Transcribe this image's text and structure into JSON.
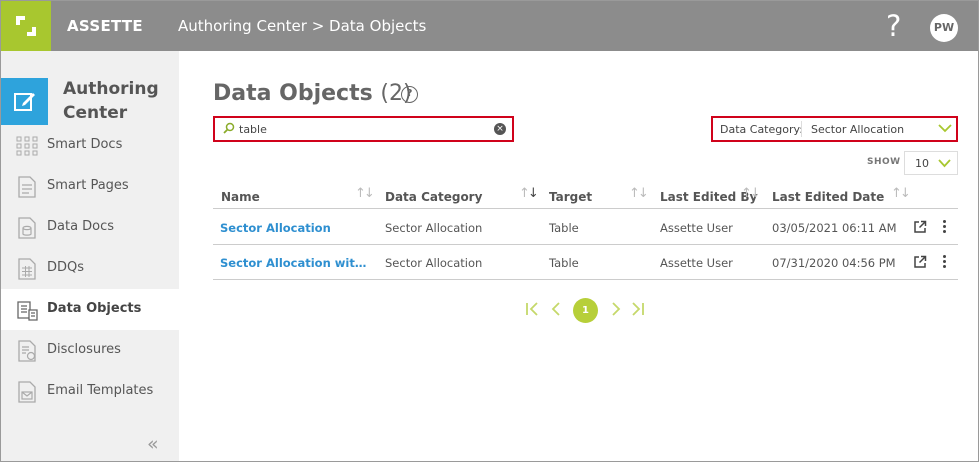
{
  "app": {
    "brand": "ASSETTE",
    "breadcrumb": "Authoring Center > Data Objects",
    "help_glyph": "?",
    "avatar_initials": "PW"
  },
  "sidebar": {
    "title": "Authoring Center",
    "items": [
      {
        "label": "Smart Docs",
        "icon": "grid-dots-icon",
        "active": false
      },
      {
        "label": "Smart Pages",
        "icon": "page-icon",
        "active": false
      },
      {
        "label": "Data Docs",
        "icon": "data-doc-icon",
        "active": false
      },
      {
        "label": "DDQs",
        "icon": "table-doc-icon",
        "active": false
      },
      {
        "label": "Data Objects",
        "icon": "data-object-icon",
        "active": true
      },
      {
        "label": "Disclosures",
        "icon": "disclosure-icon",
        "active": false
      },
      {
        "label": "Email Templates",
        "icon": "email-template-icon",
        "active": false
      }
    ],
    "collapse_glyph": "«"
  },
  "main": {
    "title": "Data Objects",
    "count": "(2)",
    "help_glyph": "?",
    "search": {
      "value": "table",
      "placeholder": ""
    },
    "category": {
      "label": "Data Category:",
      "value": "Sector Allocation"
    },
    "show": {
      "label": "SHOW",
      "value": "10"
    },
    "columns": [
      "Name",
      "Data Category",
      "Target",
      "Last Edited By",
      "Last Edited Date"
    ],
    "rows": [
      {
        "name": "Sector Allocation",
        "category": "Sector Allocation",
        "target": "Table",
        "edited_by": "Assette User",
        "edited_date": "03/05/2021 06:11 AM"
      },
      {
        "name": "Sector Allocation with Att...",
        "category": "Sector Allocation",
        "target": "Table",
        "edited_by": "Assette User",
        "edited_date": "07/31/2020 04:56 PM"
      }
    ],
    "pager": {
      "current": "1"
    }
  },
  "colors": {
    "topbar": "#8c8c8c",
    "brand_green": "#a8c72f",
    "sidebar_blue": "#2ea3dc",
    "link_blue": "#2e8fd0",
    "highlight_red": "#d0021b",
    "pager_green": "#b7cf39"
  }
}
